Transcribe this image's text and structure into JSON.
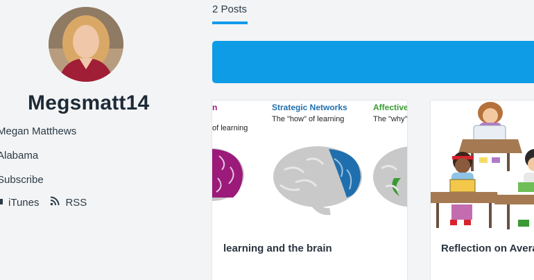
{
  "profile": {
    "username": "Megsmatt14",
    "full_name": "Megan Matthews",
    "location": "Alabama",
    "subscribe_label": "Subscribe",
    "links": {
      "itunes": "iTunes",
      "rss": "RSS"
    }
  },
  "posts_tab": {
    "label": "2 Posts"
  },
  "cards": [
    {
      "title": "learning and the brain",
      "image_text": {
        "left_heading_fragment": "n",
        "left_sub_fragment": "of learning",
        "middle_heading": "Strategic Networks",
        "middle_sub": "The \"how\" of learning",
        "right_heading": "Affective",
        "right_sub": "The \"why\""
      }
    },
    {
      "title": "Reflection on Avera"
    }
  ],
  "colors": {
    "accent": "#129bec",
    "banner": "#0e9ce6",
    "recognition": "#9b1a7a",
    "strategic": "#1f6fae",
    "affective": "#3a9a33"
  }
}
